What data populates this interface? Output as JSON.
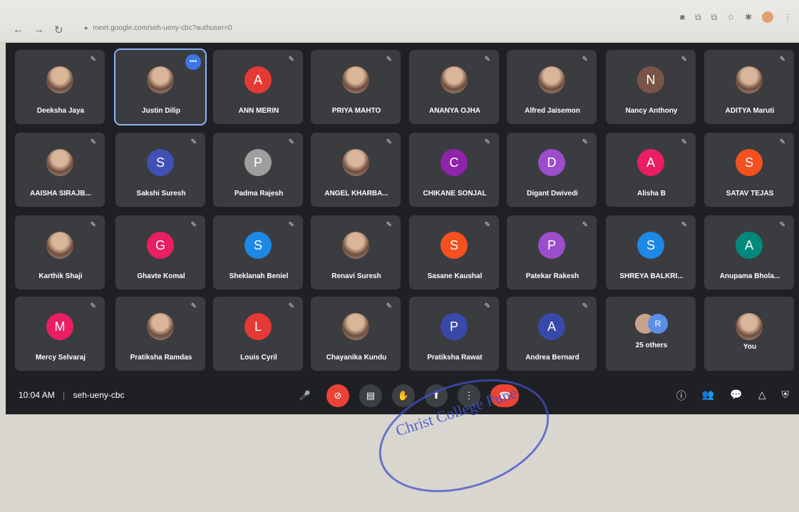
{
  "browser": {
    "url": "meet.google.com/seh-ueny-cbc?authuser=0",
    "nav": [
      "←",
      "→",
      "↻"
    ],
    "right_icons": [
      "camera-icon",
      "share-icon",
      "open-tab-icon",
      "star-icon",
      "extension-icon",
      "profile-icon",
      "menu-icon"
    ]
  },
  "tiles": [
    {
      "name": "Deeksha Jaya",
      "avatar": "",
      "photo": true
    },
    {
      "name": "Justin Dilip",
      "avatar": "",
      "photo": true,
      "active": true
    },
    {
      "name": "ANN MERIN",
      "avatar": "A",
      "color": "#e53935"
    },
    {
      "name": "PRIYA MAHTO",
      "avatar": "",
      "photo": true
    },
    {
      "name": "ANANYA OJHA",
      "avatar": "",
      "photo": true
    },
    {
      "name": "Alfred Jaisemon",
      "avatar": "",
      "photo": true
    },
    {
      "name": "Nancy Anthony",
      "avatar": "N",
      "color": "#795548"
    },
    {
      "name": "ADITYA Maruti",
      "avatar": "",
      "photo": true
    },
    {
      "name": "AAISHA SIRAJB...",
      "avatar": "",
      "photo": true
    },
    {
      "name": "Sakshi Suresh",
      "avatar": "S",
      "color": "#3f51b5"
    },
    {
      "name": "Padma Rajesh",
      "avatar": "P",
      "color": "#9e9e9e"
    },
    {
      "name": "ANGEL KHARBA...",
      "avatar": "",
      "photo": true
    },
    {
      "name": "CHIKANE SONJAL",
      "avatar": "C",
      "color": "#8e24aa"
    },
    {
      "name": "Digant Dwivedi",
      "avatar": "D",
      "color": "#9c4dcc"
    },
    {
      "name": "Alisha B",
      "avatar": "A",
      "color": "#e91e63"
    },
    {
      "name": "SATAV TEJAS",
      "avatar": "S",
      "color": "#f4511e"
    },
    {
      "name": "Karthik Shaji",
      "avatar": "",
      "photo": true
    },
    {
      "name": "Ghavte Komal",
      "avatar": "G",
      "color": "#e91e63"
    },
    {
      "name": "Sheklanah Beniel",
      "avatar": "S",
      "color": "#1e88e5"
    },
    {
      "name": "Renavi Suresh",
      "avatar": "",
      "photo": true
    },
    {
      "name": "Sasane Kaushal",
      "avatar": "S",
      "color": "#f4511e"
    },
    {
      "name": "Patekar Rakesh",
      "avatar": "P",
      "color": "#9c4dcc"
    },
    {
      "name": "SHREYA BALKRI...",
      "avatar": "S",
      "color": "#1e88e5"
    },
    {
      "name": "Anupama Bhola...",
      "avatar": "A",
      "color": "#00897b"
    },
    {
      "name": "Mercy Selvaraj",
      "avatar": "M",
      "color": "#e91e63"
    },
    {
      "name": "Pratiksha Ramdas",
      "avatar": "",
      "photo": true
    },
    {
      "name": "Louis Cyril",
      "avatar": "L",
      "color": "#e53935"
    },
    {
      "name": "Chayanika Kundu",
      "avatar": "",
      "photo": true
    },
    {
      "name": "Pratiksha Rawat",
      "avatar": "P",
      "color": "#3949ab"
    },
    {
      "name": "Andrea Bernard",
      "avatar": "A",
      "color": "#3949ab"
    },
    {
      "name": "25 others",
      "others": true
    },
    {
      "name": "You",
      "avatar": "",
      "photo": true,
      "nomic": true
    }
  ],
  "bottom": {
    "time": "10:04 AM",
    "separator": "|",
    "meeting_code": "seh-ueny-cbc",
    "controls": [
      {
        "name": "microphone-icon",
        "glyph": "🎤"
      },
      {
        "name": "camera-off-icon",
        "glyph": "⊘",
        "red": true
      },
      {
        "name": "captions-icon",
        "glyph": "▤"
      },
      {
        "name": "raise-hand-icon",
        "glyph": "✋"
      },
      {
        "name": "present-icon",
        "glyph": "⬆"
      },
      {
        "name": "more-options-icon",
        "glyph": "⋮"
      },
      {
        "name": "end-call-icon",
        "glyph": "☎",
        "end": true
      }
    ],
    "right_icons": [
      {
        "name": "info-icon",
        "glyph": "ⓘ"
      },
      {
        "name": "people-icon",
        "glyph": "👥"
      },
      {
        "name": "chat-icon",
        "glyph": "💬"
      },
      {
        "name": "activities-icon",
        "glyph": "△"
      },
      {
        "name": "host-controls-icon",
        "glyph": "⛨"
      }
    ]
  },
  "stamp_text": "Christ College Pune"
}
